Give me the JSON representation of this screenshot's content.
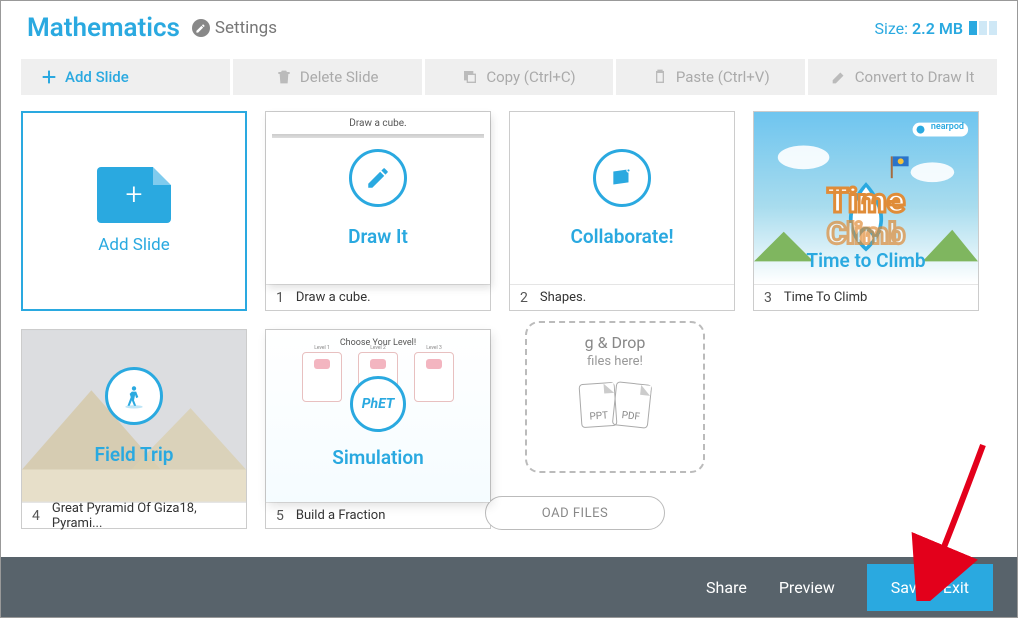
{
  "header": {
    "title": "Mathematics",
    "settings_label": "Settings",
    "size_label": "Size:",
    "size_value": "2.2 MB"
  },
  "toolbar": {
    "add_slide": "Add Slide",
    "delete_slide": "Delete Slide",
    "copy": "Copy (Ctrl+C)",
    "paste": "Paste (Ctrl+V)",
    "convert": "Convert to Draw It"
  },
  "add_card": {
    "label": "Add Slide"
  },
  "slides": [
    {
      "n": "1",
      "caption": "Draw It",
      "title": "Draw a cube.",
      "mini": "Draw a cube."
    },
    {
      "n": "2",
      "caption": "Collaborate!",
      "title": "Shapes."
    },
    {
      "n": "3",
      "caption": "Time to Climb",
      "title": "Time To Climb",
      "brand": "nearpod"
    },
    {
      "n": "4",
      "caption": "Field Trip",
      "title": "Great Pyramid Of Giza18, Pyrami..."
    },
    {
      "n": "5",
      "caption": "Simulation",
      "title": "Build a Fraction",
      "mini": "Choose Your Level!",
      "circle_text": "PhET"
    }
  ],
  "drop": {
    "line1": "g & Drop",
    "line2": "files here!",
    "doc1": "PPT",
    "doc2": "PDF"
  },
  "upload_btn": "OAD FILES",
  "bottombar": {
    "share": "Share",
    "preview": "Preview",
    "save_exit": "Save & Exit"
  },
  "levels": [
    "Level 1",
    "Level 2",
    "Level 3"
  ]
}
